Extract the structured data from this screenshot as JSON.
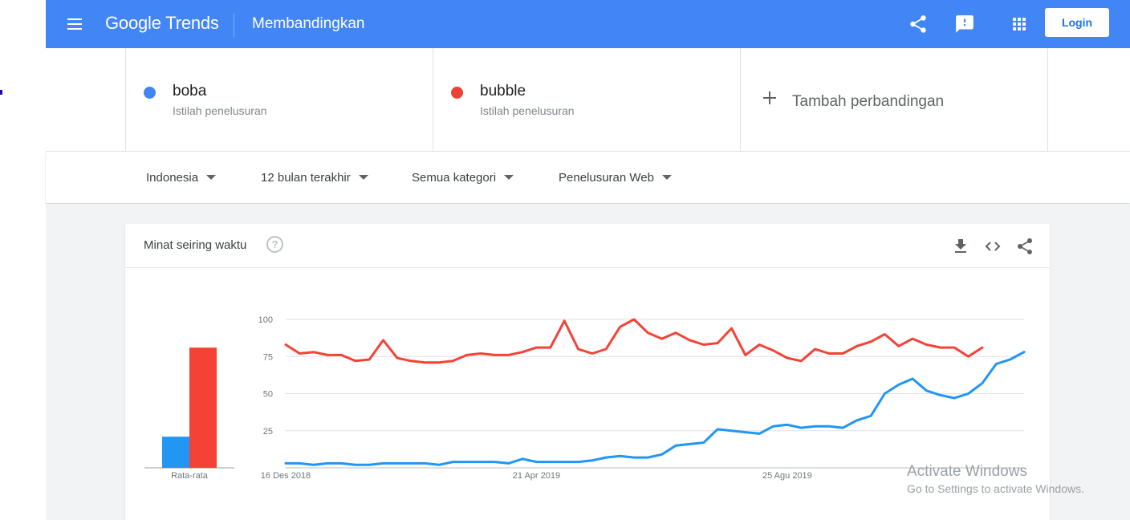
{
  "appbar": {
    "logo_google": "Google",
    "logo_trends": "Trends",
    "page_title": "Membandingkan",
    "login_label": "Login",
    "icons": [
      "menu-icon",
      "share-icon",
      "feedback-icon",
      "apps-icon"
    ]
  },
  "terms": [
    {
      "name": "boba",
      "subtitle": "Istilah penelusuran",
      "color": "#4285f4"
    },
    {
      "name": "bubble",
      "subtitle": "Istilah penelusuran",
      "color": "#ea4335"
    }
  ],
  "add_comparison": {
    "label": "Tambah perbandingan",
    "icon": "plus-icon"
  },
  "filters": {
    "region": "Indonesia",
    "time_range": "12 bulan terakhir",
    "category": "Semua kategori",
    "search_type": "Penelusuran Web"
  },
  "interest_card": {
    "title": "Minat seiring waktu",
    "help": "?",
    "icons": [
      "download-icon",
      "embed-icon",
      "share-icon"
    ]
  },
  "chart_data": {
    "type": "line",
    "y_ticks": [
      "100",
      "75",
      "50",
      "25"
    ],
    "ylim": [
      0,
      100
    ],
    "x_tick_labels": [
      "16 Des 2018",
      "21 Apr 2019",
      "25 Agu 2019"
    ],
    "x_tick_indices": [
      0,
      18,
      36
    ],
    "grid": true,
    "colors": {
      "boba": "#2196f3",
      "bubble": "#f44336"
    },
    "series": [
      {
        "name": "boba",
        "values": [
          3,
          3,
          2,
          3,
          3,
          2,
          2,
          3,
          3,
          3,
          3,
          2,
          4,
          4,
          4,
          4,
          3,
          6,
          4,
          4,
          4,
          4,
          5,
          7,
          8,
          7,
          7,
          9,
          15,
          16,
          17,
          26,
          25,
          24,
          23,
          28,
          29,
          27,
          28,
          28,
          27,
          32,
          35,
          50,
          56,
          60,
          52,
          49,
          47,
          50,
          57,
          70,
          73,
          78
        ]
      },
      {
        "name": "bubble",
        "values": [
          83,
          77,
          78,
          76,
          76,
          72,
          73,
          86,
          74,
          72,
          71,
          71,
          72,
          76,
          77,
          76,
          76,
          78,
          81,
          81,
          99,
          80,
          77,
          80,
          95,
          100,
          91,
          87,
          91,
          86,
          83,
          84,
          94,
          76,
          83,
          79,
          74,
          72,
          80,
          77,
          77,
          82,
          85,
          90,
          82,
          87,
          83,
          81,
          81,
          75,
          81
        ]
      }
    ],
    "average_bars": {
      "label": "Rata-rata",
      "values": [
        {
          "name": "boba",
          "value": 21
        },
        {
          "name": "bubble",
          "value": 81
        }
      ]
    }
  },
  "watermark": {
    "line1": "Activate Windows",
    "line2": "Go to Settings to activate Windows."
  }
}
